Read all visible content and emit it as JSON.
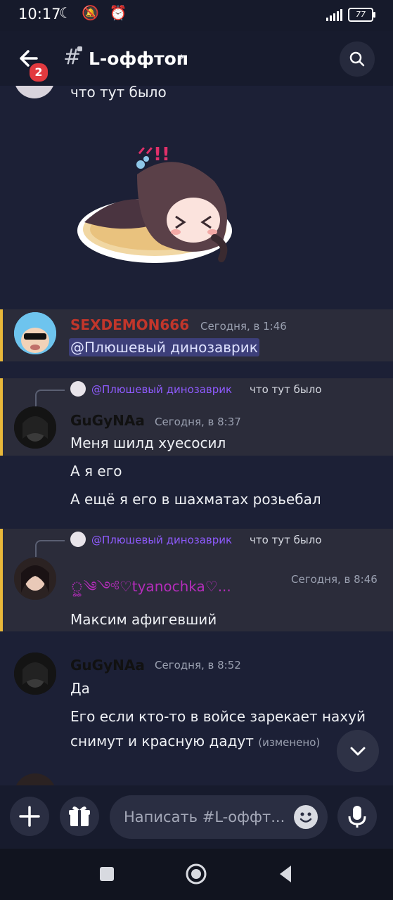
{
  "status": {
    "time": "10:17",
    "icons": "☾ 🔕 ⏰",
    "battery": "77"
  },
  "header": {
    "badge": "2",
    "channel": "L-оффтоп",
    "chevron": "›"
  },
  "messages": {
    "m0": {
      "text": "что тут было"
    },
    "m1": {
      "author": "SEXDEMON666",
      "time": "Сегодня, в 1:46",
      "mention": "@Плюшевый динозаврик"
    },
    "m2": {
      "reply_mention": "@Плюшевый динозаврик",
      "reply_text": "что тут было",
      "author": "GuGyNAa",
      "time": "Сегодня, в 8:37",
      "lines": [
        "Меня шилд хуесосил",
        "А я его",
        "А ещё я его в шахматах розьебал"
      ]
    },
    "m3": {
      "reply_mention": "@Плюшевый динозаврик",
      "reply_text": "что тут было",
      "author": "ৣ༄༺♡tyanochka♡...",
      "time": "Сегодня, в 8:46",
      "text": "Максим афигевший"
    },
    "m4": {
      "author": "GuGyNAa",
      "time": "Сегодня, в 8:52",
      "lines": [
        "Да",
        "Его если кто-то в войсе зарекает нахуй",
        "снимут и красную дадут"
      ],
      "edited": "(изменено)"
    }
  },
  "composer": {
    "placeholder": "Написать #L-оффт..."
  },
  "colors": {
    "accent_bar": "#e8b83a",
    "sexdemon": "#c2362b",
    "tyanochka": "#b52dbb",
    "mention": "#8f5bff",
    "badge": "#e23a3f"
  }
}
